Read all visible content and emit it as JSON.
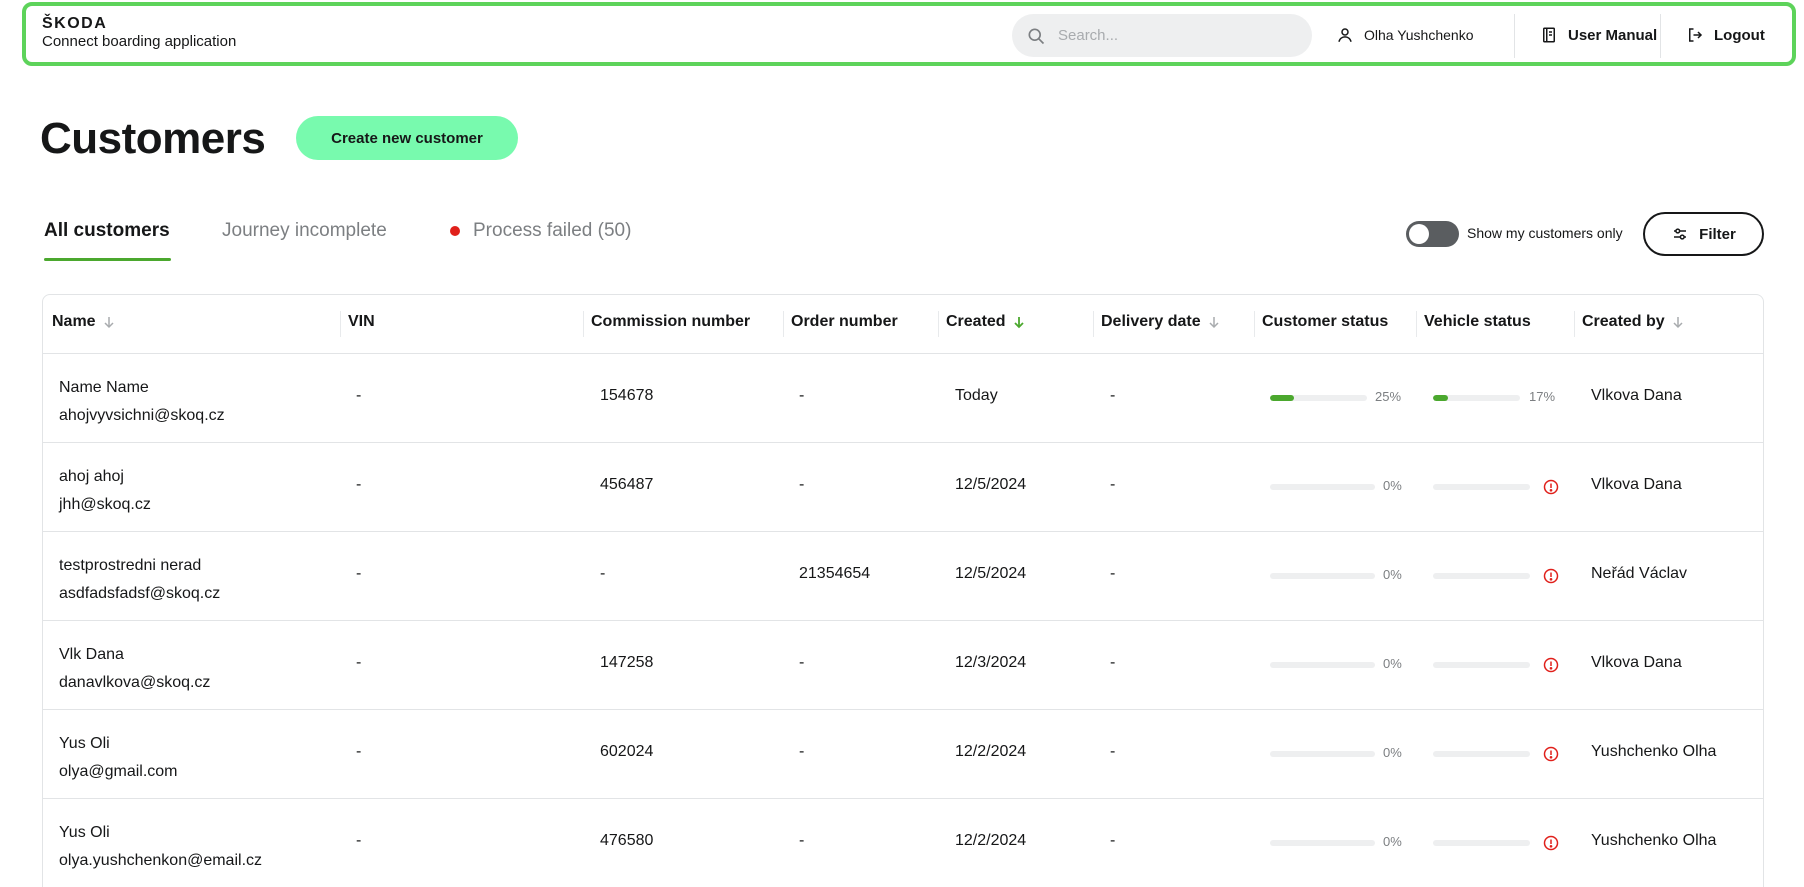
{
  "header": {
    "brand": "ŠKODA",
    "app_name": "Connect boarding application",
    "search_placeholder": "Search...",
    "user_name": "Olha Yushchenko",
    "manual_label": "User Manual",
    "logout_label": "Logout"
  },
  "page": {
    "title": "Customers",
    "create_label": "Create new customer"
  },
  "tabs": [
    {
      "label": "All customers",
      "active": true
    },
    {
      "label": "Journey incomplete",
      "active": false
    },
    {
      "label": "Process failed (50)",
      "active": false
    }
  ],
  "toolbar": {
    "toggle_label": "Show my customers only",
    "toggle_on": false,
    "filter_label": "Filter"
  },
  "table": {
    "columns": [
      "Name",
      "VIN",
      "Commission number",
      "Order number",
      "Created",
      "Delivery date",
      "Customer status",
      "Vehicle status",
      "Created by"
    ],
    "rows": [
      {
        "name": "Name Name",
        "email": "ahojvyvsichni@skoq.cz",
        "vin": "-",
        "commission": "154678",
        "order": "-",
        "created": "Today",
        "delivery": "-",
        "customer_status": 25,
        "customer_status_label": "25%",
        "vehicle_status": 17,
        "vehicle_status_label": "17%",
        "vehicle_alert": false,
        "created_by": "Vlkova Dana"
      },
      {
        "name": "ahoj ahoj",
        "email": "jhh@skoq.cz",
        "vin": "-",
        "commission": "456487",
        "order": "-",
        "created": "12/5/2024",
        "delivery": "-",
        "customer_status": 0,
        "customer_status_label": "0%",
        "vehicle_status": 0,
        "vehicle_status_label": "",
        "vehicle_alert": true,
        "created_by": "Vlkova Dana"
      },
      {
        "name": "testprostredni nerad",
        "email": "asdfadsfadsf@skoq.cz",
        "vin": "-",
        "commission": "-",
        "order": "21354654",
        "created": "12/5/2024",
        "delivery": "-",
        "customer_status": 0,
        "customer_status_label": "0%",
        "vehicle_status": 0,
        "vehicle_status_label": "",
        "vehicle_alert": true,
        "created_by": "Neřád Václav"
      },
      {
        "name": "Vlk Dana",
        "email": "danavlkova@skoq.cz",
        "vin": "-",
        "commission": "147258",
        "order": "-",
        "created": "12/3/2024",
        "delivery": "-",
        "customer_status": 0,
        "customer_status_label": "0%",
        "vehicle_status": 0,
        "vehicle_status_label": "",
        "vehicle_alert": true,
        "created_by": "Vlkova Dana"
      },
      {
        "name": "Yus Oli",
        "email": "olya@gmail.com",
        "vin": "-",
        "commission": "602024",
        "order": "-",
        "created": "12/2/2024",
        "delivery": "-",
        "customer_status": 0,
        "customer_status_label": "0%",
        "vehicle_status": 0,
        "vehicle_status_label": "",
        "vehicle_alert": true,
        "created_by": "Yushchenko Olha"
      },
      {
        "name": "Yus Oli",
        "email": "olya.yushchenkon@email.cz",
        "vin": "-",
        "commission": "476580",
        "order": "-",
        "created": "12/2/2024",
        "delivery": "-",
        "customer_status": 0,
        "customer_status_label": "0%",
        "vehicle_status": 0,
        "vehicle_status_label": "",
        "vehicle_alert": true,
        "created_by": "Yushchenko Olha"
      }
    ]
  },
  "colors": {
    "accent_green": "#4ba82e",
    "button_mint": "#78faae",
    "alert_red": "#e0201b",
    "header_highlight": "#5dd35a"
  },
  "icons": {
    "search": "search-icon",
    "user": "user-icon",
    "manual": "book-icon",
    "logout": "logout-icon",
    "filter": "sliders-icon",
    "sort": "arrow-down-icon",
    "alert": "alert-circle-icon"
  }
}
